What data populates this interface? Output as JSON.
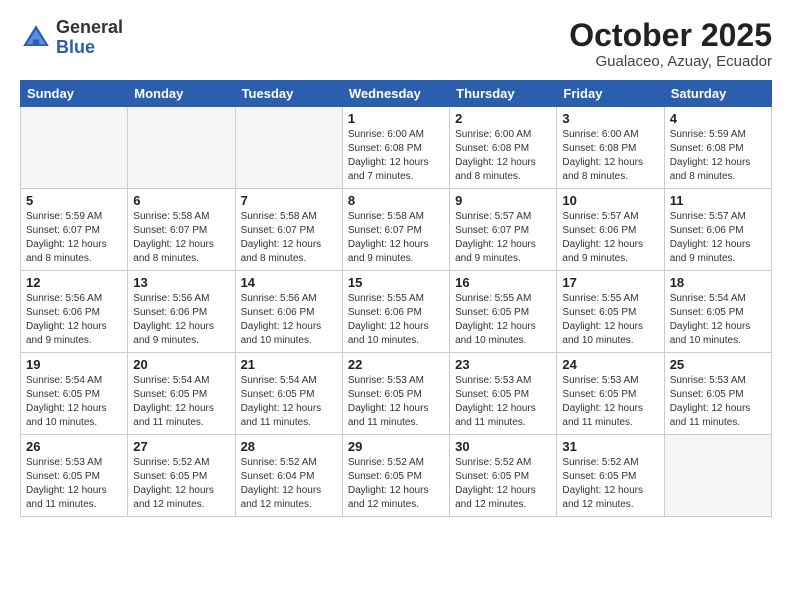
{
  "header": {
    "logo_general": "General",
    "logo_blue": "Blue",
    "month_title": "October 2025",
    "location": "Gualaceo, Azuay, Ecuador"
  },
  "weekdays": [
    "Sunday",
    "Monday",
    "Tuesday",
    "Wednesday",
    "Thursday",
    "Friday",
    "Saturday"
  ],
  "weeks": [
    [
      {
        "day": "",
        "info": ""
      },
      {
        "day": "",
        "info": ""
      },
      {
        "day": "",
        "info": ""
      },
      {
        "day": "1",
        "info": "Sunrise: 6:00 AM\nSunset: 6:08 PM\nDaylight: 12 hours\nand 7 minutes."
      },
      {
        "day": "2",
        "info": "Sunrise: 6:00 AM\nSunset: 6:08 PM\nDaylight: 12 hours\nand 8 minutes."
      },
      {
        "day": "3",
        "info": "Sunrise: 6:00 AM\nSunset: 6:08 PM\nDaylight: 12 hours\nand 8 minutes."
      },
      {
        "day": "4",
        "info": "Sunrise: 5:59 AM\nSunset: 6:08 PM\nDaylight: 12 hours\nand 8 minutes."
      }
    ],
    [
      {
        "day": "5",
        "info": "Sunrise: 5:59 AM\nSunset: 6:07 PM\nDaylight: 12 hours\nand 8 minutes."
      },
      {
        "day": "6",
        "info": "Sunrise: 5:58 AM\nSunset: 6:07 PM\nDaylight: 12 hours\nand 8 minutes."
      },
      {
        "day": "7",
        "info": "Sunrise: 5:58 AM\nSunset: 6:07 PM\nDaylight: 12 hours\nand 8 minutes."
      },
      {
        "day": "8",
        "info": "Sunrise: 5:58 AM\nSunset: 6:07 PM\nDaylight: 12 hours\nand 9 minutes."
      },
      {
        "day": "9",
        "info": "Sunrise: 5:57 AM\nSunset: 6:07 PM\nDaylight: 12 hours\nand 9 minutes."
      },
      {
        "day": "10",
        "info": "Sunrise: 5:57 AM\nSunset: 6:06 PM\nDaylight: 12 hours\nand 9 minutes."
      },
      {
        "day": "11",
        "info": "Sunrise: 5:57 AM\nSunset: 6:06 PM\nDaylight: 12 hours\nand 9 minutes."
      }
    ],
    [
      {
        "day": "12",
        "info": "Sunrise: 5:56 AM\nSunset: 6:06 PM\nDaylight: 12 hours\nand 9 minutes."
      },
      {
        "day": "13",
        "info": "Sunrise: 5:56 AM\nSunset: 6:06 PM\nDaylight: 12 hours\nand 9 minutes."
      },
      {
        "day": "14",
        "info": "Sunrise: 5:56 AM\nSunset: 6:06 PM\nDaylight: 12 hours\nand 10 minutes."
      },
      {
        "day": "15",
        "info": "Sunrise: 5:55 AM\nSunset: 6:06 PM\nDaylight: 12 hours\nand 10 minutes."
      },
      {
        "day": "16",
        "info": "Sunrise: 5:55 AM\nSunset: 6:05 PM\nDaylight: 12 hours\nand 10 minutes."
      },
      {
        "day": "17",
        "info": "Sunrise: 5:55 AM\nSunset: 6:05 PM\nDaylight: 12 hours\nand 10 minutes."
      },
      {
        "day": "18",
        "info": "Sunrise: 5:54 AM\nSunset: 6:05 PM\nDaylight: 12 hours\nand 10 minutes."
      }
    ],
    [
      {
        "day": "19",
        "info": "Sunrise: 5:54 AM\nSunset: 6:05 PM\nDaylight: 12 hours\nand 10 minutes."
      },
      {
        "day": "20",
        "info": "Sunrise: 5:54 AM\nSunset: 6:05 PM\nDaylight: 12 hours\nand 11 minutes."
      },
      {
        "day": "21",
        "info": "Sunrise: 5:54 AM\nSunset: 6:05 PM\nDaylight: 12 hours\nand 11 minutes."
      },
      {
        "day": "22",
        "info": "Sunrise: 5:53 AM\nSunset: 6:05 PM\nDaylight: 12 hours\nand 11 minutes."
      },
      {
        "day": "23",
        "info": "Sunrise: 5:53 AM\nSunset: 6:05 PM\nDaylight: 12 hours\nand 11 minutes."
      },
      {
        "day": "24",
        "info": "Sunrise: 5:53 AM\nSunset: 6:05 PM\nDaylight: 12 hours\nand 11 minutes."
      },
      {
        "day": "25",
        "info": "Sunrise: 5:53 AM\nSunset: 6:05 PM\nDaylight: 12 hours\nand 11 minutes."
      }
    ],
    [
      {
        "day": "26",
        "info": "Sunrise: 5:53 AM\nSunset: 6:05 PM\nDaylight: 12 hours\nand 11 minutes."
      },
      {
        "day": "27",
        "info": "Sunrise: 5:52 AM\nSunset: 6:05 PM\nDaylight: 12 hours\nand 12 minutes."
      },
      {
        "day": "28",
        "info": "Sunrise: 5:52 AM\nSunset: 6:04 PM\nDaylight: 12 hours\nand 12 minutes."
      },
      {
        "day": "29",
        "info": "Sunrise: 5:52 AM\nSunset: 6:05 PM\nDaylight: 12 hours\nand 12 minutes."
      },
      {
        "day": "30",
        "info": "Sunrise: 5:52 AM\nSunset: 6:05 PM\nDaylight: 12 hours\nand 12 minutes."
      },
      {
        "day": "31",
        "info": "Sunrise: 5:52 AM\nSunset: 6:05 PM\nDaylight: 12 hours\nand 12 minutes."
      },
      {
        "day": "",
        "info": ""
      }
    ]
  ]
}
